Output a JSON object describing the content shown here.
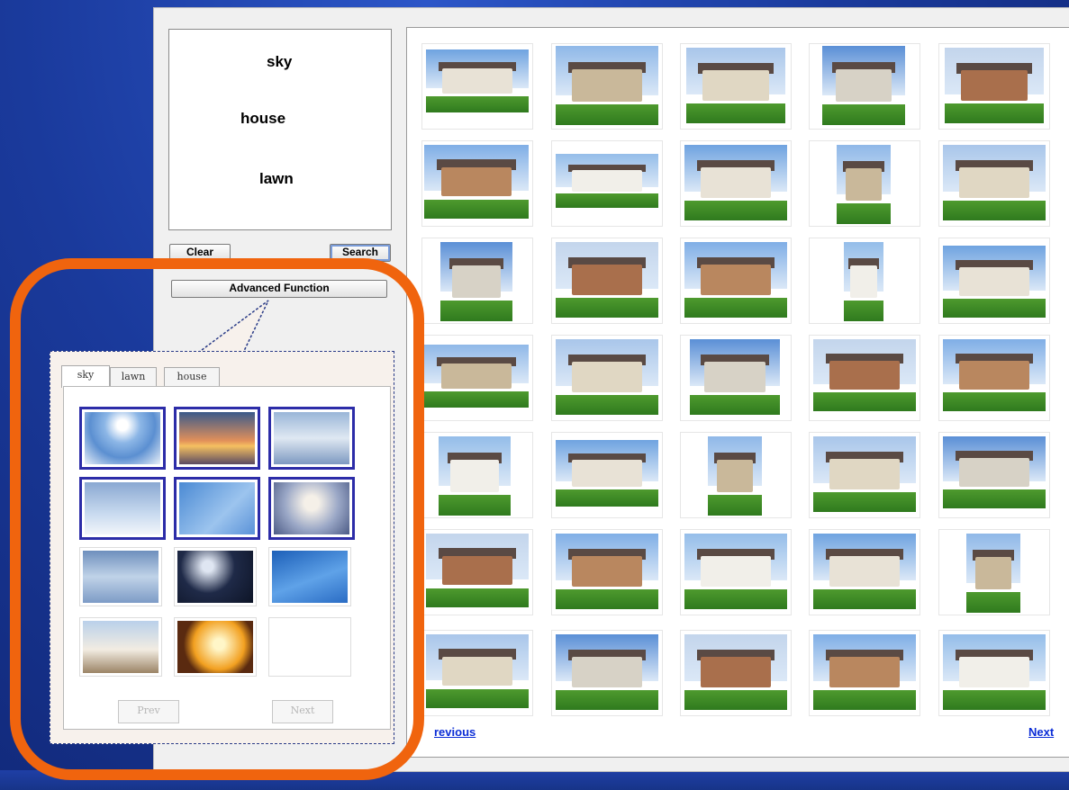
{
  "query": {
    "words": [
      "sky",
      "house",
      "lawn"
    ]
  },
  "buttons": {
    "clear": "Clear",
    "search": "Search",
    "advanced": "Advanced Function"
  },
  "results": {
    "rows": 7,
    "cols": 5,
    "prev_label": "revious",
    "next_label": "Next"
  },
  "advanced_panel": {
    "tabs": [
      "sky",
      "lawn",
      "house"
    ],
    "active_tab": "sky",
    "prev_button": "Prev",
    "next_button": "Next"
  },
  "colors": {
    "callout_ring": "#f0640e",
    "link": "#0a2cd6",
    "selection_border": "#2c2ca8"
  }
}
